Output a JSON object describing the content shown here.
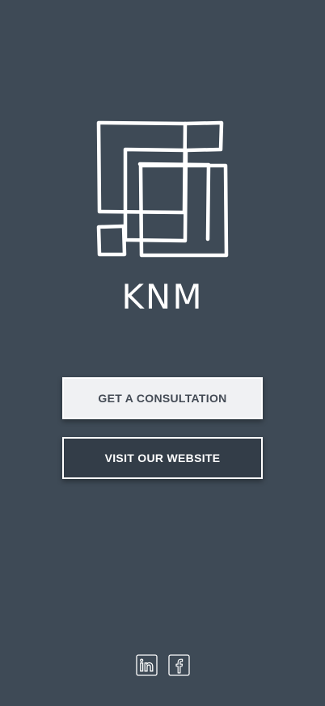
{
  "brand": {
    "logo_icon": "knm-squares-logo-icon",
    "name": "KNM"
  },
  "buttons": {
    "consultation_label": "GET A CONSULTATION",
    "website_label": "VISIT OUR WEBSITE"
  },
  "social": [
    {
      "icon": "linkedin-icon",
      "network": "LinkedIn"
    },
    {
      "icon": "facebook-icon",
      "network": "Facebook"
    }
  ],
  "colors": {
    "background": "#3e4a56",
    "consultation_button_bg": "#f0f1f3",
    "website_button_bg": "#333d48",
    "foreground": "#ffffff"
  }
}
